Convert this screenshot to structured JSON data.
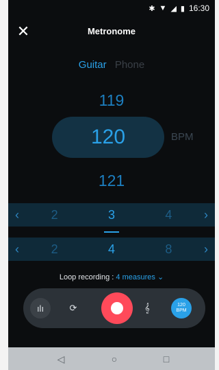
{
  "status": {
    "time": "16:30",
    "icons": [
      "bluetooth-icon",
      "wifi-icon",
      "signal-icon",
      "battery-icon"
    ]
  },
  "header": {
    "close_label": "✕",
    "title": "Metronome"
  },
  "tabs": {
    "guitar": "Guitar",
    "phone": "Phone"
  },
  "bpm": {
    "prev": "119",
    "current": "120",
    "next": "121",
    "unit": "BPM"
  },
  "row1": {
    "left": "2",
    "center": "3",
    "right": "4"
  },
  "row2": {
    "left": "2",
    "center": "4",
    "right": "8"
  },
  "loop": {
    "prefix": "Loop recording : ",
    "value": "4 measures",
    "chevron": "⌄"
  },
  "controls": {
    "meter_icon": "ılı",
    "sync_icon": "⟳",
    "tempo_icon": "𝄞",
    "bpm_top": "120",
    "bpm_bottom": "BPM"
  },
  "colors": {
    "accent": "#2aa1e8",
    "record": "#ff4a5a"
  }
}
